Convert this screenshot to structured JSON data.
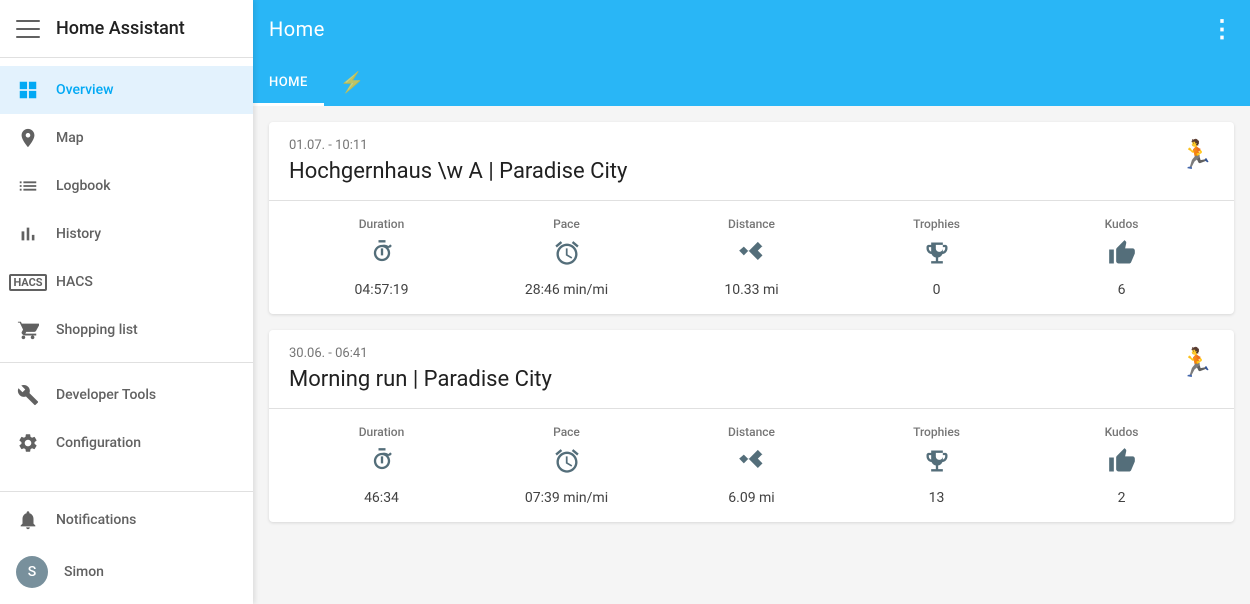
{
  "sidebar": {
    "title": "Home Assistant",
    "menu_icon": "menu-icon",
    "items": [
      {
        "id": "overview",
        "label": "Overview",
        "icon": "grid",
        "active": true
      },
      {
        "id": "map",
        "label": "Map",
        "icon": "person-pin"
      },
      {
        "id": "logbook",
        "label": "Logbook",
        "icon": "list"
      },
      {
        "id": "history",
        "label": "History",
        "icon": "bar-chart"
      },
      {
        "id": "hacs",
        "label": "HACS",
        "icon": "hacs"
      },
      {
        "id": "shopping-list",
        "label": "Shopping list",
        "icon": "cart"
      }
    ],
    "tools": [
      {
        "id": "developer-tools",
        "label": "Developer Tools",
        "icon": "wrench"
      },
      {
        "id": "configuration",
        "label": "Configuration",
        "icon": "gear"
      }
    ],
    "footer": [
      {
        "id": "notifications",
        "label": "Notifications",
        "icon": "bell"
      }
    ],
    "user": {
      "label": "Simon",
      "initial": "S"
    }
  },
  "header": {
    "title": "Home",
    "more_options": "⋮"
  },
  "tabs": [
    {
      "id": "home",
      "label": "HOME",
      "active": true
    },
    {
      "id": "lightning",
      "label": "",
      "icon": "⚡"
    }
  ],
  "activities": [
    {
      "id": "activity-1",
      "date": "01.07. - 10:11",
      "title": "Hochgernhaus \\w A | Paradise City",
      "type_icon": "🏃",
      "stats": {
        "duration": {
          "label": "Duration",
          "icon": "⏱",
          "value": "04:57:19"
        },
        "pace": {
          "label": "Pace",
          "icon": "⏲",
          "value": "28:46 min/mi"
        },
        "distance": {
          "label": "Distance",
          "icon": "📏",
          "value": "10.33 mi"
        },
        "trophies": {
          "label": "Trophies",
          "icon": "🏆",
          "value": "0"
        },
        "kudos": {
          "label": "Kudos",
          "icon": "👍",
          "value": "6"
        }
      }
    },
    {
      "id": "activity-2",
      "date": "30.06. - 06:41",
      "title": "Morning run | Paradise City",
      "type_icon": "🏃",
      "stats": {
        "duration": {
          "label": "Duration",
          "icon": "⏱",
          "value": "46:34"
        },
        "pace": {
          "label": "Pace",
          "icon": "⏲",
          "value": "07:39 min/mi"
        },
        "distance": {
          "label": "Distance",
          "icon": "📏",
          "value": "6.09 mi"
        },
        "trophies": {
          "label": "Trophies",
          "icon": "🏆",
          "value": "13"
        },
        "kudos": {
          "label": "Kudos",
          "icon": "👍",
          "value": "2"
        }
      }
    }
  ]
}
